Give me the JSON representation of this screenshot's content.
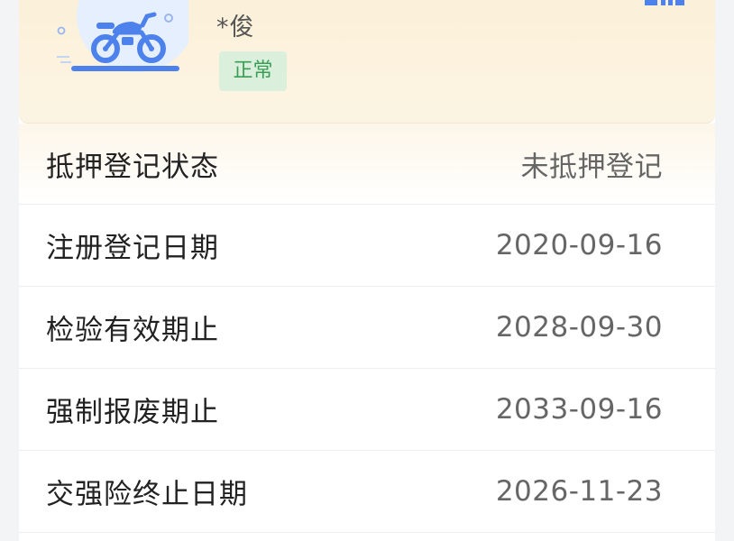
{
  "header": {
    "owner_name": "*俊",
    "status": "正常",
    "status_color": "#3a9d55",
    "vehicle_icon": "motorcycle-icon",
    "accent_color": "#4d82ec"
  },
  "rows": [
    {
      "label": "抵押登记状态",
      "value": "未抵押登记"
    },
    {
      "label": "注册登记日期",
      "value": "2020-09-16"
    },
    {
      "label": "检验有效期止",
      "value": "2028-09-30"
    },
    {
      "label": "强制报废期止",
      "value": "2033-09-16"
    },
    {
      "label": "交强险终止日期",
      "value": "2026-11-23"
    }
  ]
}
